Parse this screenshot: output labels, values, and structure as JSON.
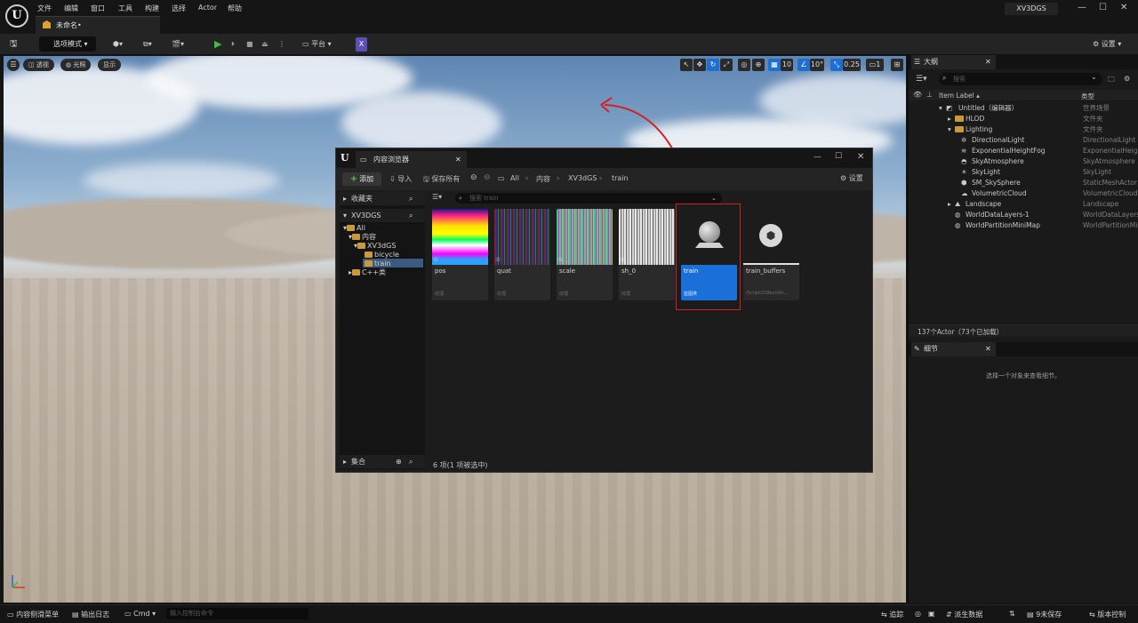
{
  "menu": [
    "文件",
    "编辑",
    "窗口",
    "工具",
    "构建",
    "选择",
    "Actor",
    "帮助"
  ],
  "doc_tab": "未命名•",
  "app_title": "XV3DGS",
  "toolbar": {
    "mode_label": "选项模式",
    "platform_label": "平台",
    "settings_label": "设置"
  },
  "viewport": {
    "perspective": "透视",
    "lit": "光照",
    "show": "显示",
    "grid_size": "10",
    "rotation_snap": "10°",
    "scale_snap": "0.25",
    "camera_speed": "1"
  },
  "content_browser": {
    "title": "内容浏览器",
    "add": "添加",
    "import": "导入",
    "save_all": "保存所有",
    "breadcrumb": [
      "All",
      "内容",
      "XV3dGS",
      "train"
    ],
    "settings": "设置",
    "favorites": "收藏夹",
    "project": "XV3DGS",
    "tree": [
      "All",
      "内容",
      "XV3dGS",
      "bicycle",
      "train",
      "C++类"
    ],
    "collections": "集合",
    "search_placeholder": "搜索 train",
    "assets": [
      {
        "name": "pos",
        "type": "纹理"
      },
      {
        "name": "quat",
        "type": "纹理"
      },
      {
        "name": "scale",
        "type": "纹理"
      },
      {
        "name": "sh_0",
        "type": "纹理"
      },
      {
        "name": "train",
        "type": "蓝图类"
      },
      {
        "name": "train_buffers",
        "type": "/Script/GSRuntim..."
      }
    ],
    "status": "6 项(1 项被选中)"
  },
  "outliner": {
    "title": "大纲",
    "search_placeholder": "搜索",
    "col_label": "Item Label ▴",
    "col_type": "类型",
    "rows": [
      {
        "label": "Untitled（编辑器）",
        "type": "世界场景"
      },
      {
        "label": "HLOD",
        "type": "文件夹"
      },
      {
        "label": "Lighting",
        "type": "文件夹"
      },
      {
        "label": "DirectionalLight",
        "type": "DirectionalLight"
      },
      {
        "label": "ExponentialHeightFog",
        "type": "ExponentialHeightFog"
      },
      {
        "label": "SkyAtmosphere",
        "type": "SkyAtmosphere"
      },
      {
        "label": "SkyLight",
        "type": "SkyLight"
      },
      {
        "label": "SM_SkySphere",
        "type": "StaticMeshActor"
      },
      {
        "label": "VolumetricCloud",
        "type": "VolumetricCloud"
      },
      {
        "label": "Landscape",
        "type": "Landscape"
      },
      {
        "label": "WorldDataLayers-1",
        "type": "WorldDataLayers"
      },
      {
        "label": "WorldPartitionMiniMap",
        "type": "WorldPartitionMiniMap"
      }
    ],
    "actor_count": "137个Actor（73个已加载）"
  },
  "details": {
    "title": "细节",
    "empty_msg": "选择一个对象来查看细节。"
  },
  "statusbar": {
    "content_drawer": "内容侧滑菜单",
    "output_log": "输出日志",
    "cmd": "Cmd",
    "cmd_placeholder": "输入控制台命令",
    "trace": "追踪",
    "derived_data": "派生数据",
    "unsaved": "9未保存",
    "revision_control": "版本控制"
  }
}
